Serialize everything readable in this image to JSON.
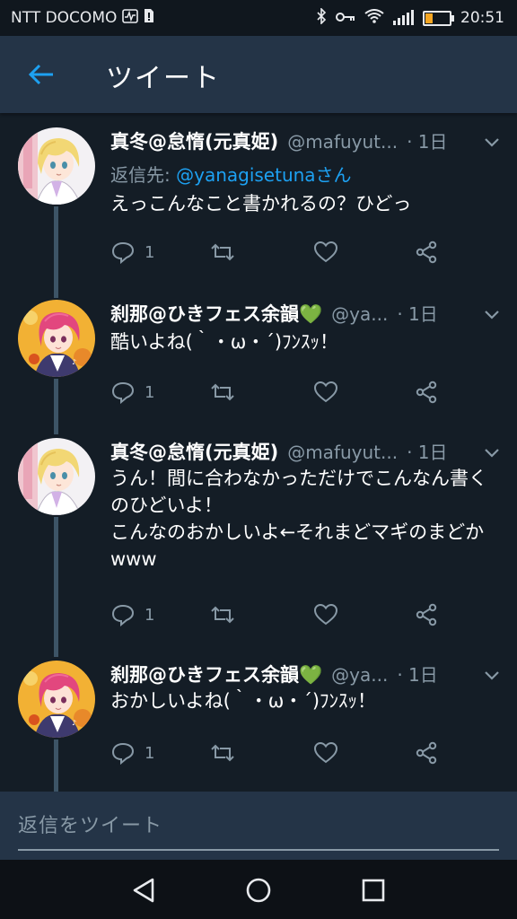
{
  "status_bar": {
    "carrier": "NTT DOCOMO",
    "time": "20:51",
    "battery_level": 0.3,
    "icons": [
      "activity-icon",
      "sim-alert-icon",
      "bluetooth-icon",
      "key-icon",
      "wifi-icon",
      "signal-icon",
      "battery-icon"
    ]
  },
  "header": {
    "title": "ツイート",
    "back_icon": "arrow-left-icon"
  },
  "colors": {
    "background": "#141d26",
    "header": "#243447",
    "accent": "#1da1f2",
    "secondary_text": "#8899a6"
  },
  "tweets": [
    {
      "name": "真冬@怠惰(元真姫)",
      "handle": "@mafuyut...",
      "time": "· 1日",
      "reply_prefix": "返信先: ",
      "reply_to": "@yanagisetunaさん",
      "text": "えっこんなこと書かれるの？ひどっ",
      "reply_count": "1",
      "avatar": "blonde-avatar"
    },
    {
      "name": "刹那@ひきフェス余韻💚",
      "handle": "@ya...",
      "time": "· 1日",
      "text": "酷いよね(｀・ω・´)ﾌﾝｽｯ！",
      "reply_count": "1",
      "avatar": "pink-hair-avatar"
    },
    {
      "name": "真冬@怠惰(元真姫)",
      "handle": "@mafuyut...",
      "time": "· 1日",
      "text": "うん！間に合わなかっただけでこんなん書くのひどいよ！\nこんなのおかしいよ←それまどマギのまどかwww",
      "reply_count": "1",
      "avatar": "blonde-avatar"
    },
    {
      "name": "刹那@ひきフェス余韻💚",
      "handle": "@ya...",
      "time": "· 1日",
      "text": "おかしいよね(｀・ω・´)ﾌﾝｽｯ！",
      "reply_count": "1",
      "avatar": "pink-hair-avatar"
    }
  ],
  "reply_bar": {
    "placeholder": "返信をツイート"
  },
  "nav_bar": {
    "buttons": [
      "back-triangle-icon",
      "home-circle-icon",
      "recents-square-icon"
    ]
  }
}
